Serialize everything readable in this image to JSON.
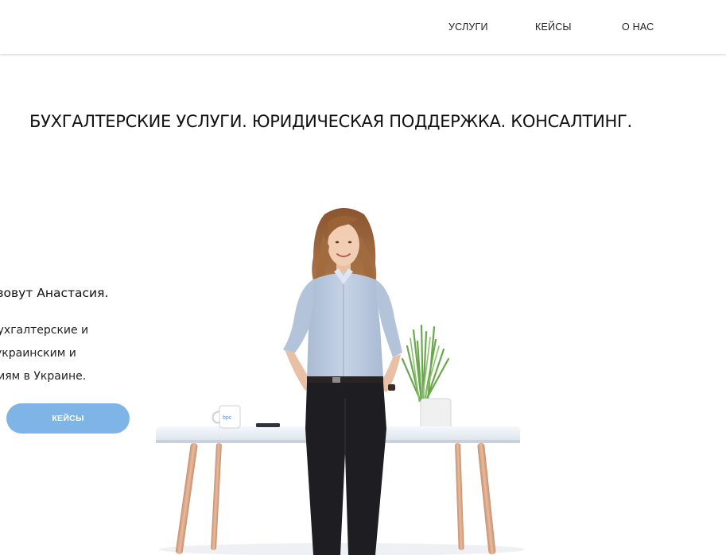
{
  "nav": {
    "services": "УСЛУГИ",
    "cases": "КЕЙСЫ",
    "about": "О НАС"
  },
  "hero": {
    "headline": "БУХГАЛТЕРСКИЕ УСЛУГИ. ЮРИДИЧЕСКАЯ ПОДДЕРЖКА. КОНСАЛТИНГ.",
    "intro_name": "я зовут Анастасия.",
    "intro_line1": "бухгалтерские и",
    "intro_line2": "украинским и",
    "intro_line3": "ниям в Украине.",
    "button_label": "КЕЙСЫ",
    "mug_logo": "bpc"
  },
  "colors": {
    "accent_button": "#7fb5e6",
    "shirt": "#b9c8de",
    "trousers": "#1d1d22",
    "table_top": "#e9eef4",
    "table_legs": "#d9a98a"
  }
}
